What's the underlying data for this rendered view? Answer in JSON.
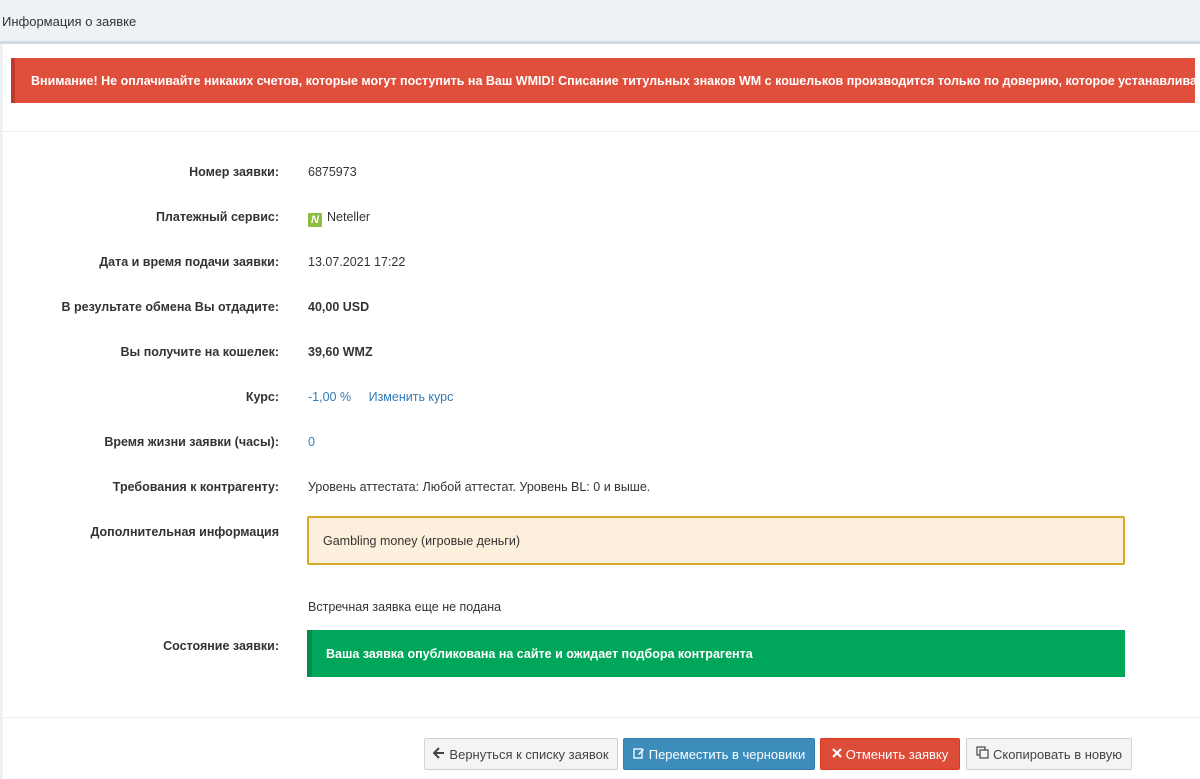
{
  "header": {
    "title": "Информация о заявке"
  },
  "alert": "Внимание! Не оплачивайте никаких счетов, которые могут поступить на Ваш WMID! Списание титульных знаков WM с кошельков производится только по доверию, которое устанавливается один раз.",
  "fields": {
    "order_number": {
      "label": "Номер заявки:",
      "value": "6875973"
    },
    "payment_service": {
      "label": "Платежный сервис:",
      "icon_letter": "N",
      "value": "Neteller"
    },
    "date": {
      "label": "Дата и время подачи заявки:",
      "value": "13.07.2021 17:22"
    },
    "give": {
      "label": "В результате обмена Вы отдадите:",
      "value": "40,00 USD"
    },
    "receive": {
      "label": "Вы получите на кошелек:",
      "value": "39,60 WMZ"
    },
    "rate": {
      "label": "Курс:",
      "value": "-1,00 %",
      "change_link": "Изменить курс"
    },
    "lifetime": {
      "label": "Время жизни заявки (часы):",
      "value": "0"
    },
    "requirements": {
      "label": "Требования к контрагенту:",
      "value": "Уровень аттестата: Любой аттестат. Уровень BL: 0 и выше."
    },
    "additional": {
      "label": "Дополнительная информация",
      "value": "Gambling money (игровые деньги)"
    },
    "counter_order": "Встречная заявка еще не подана",
    "status": {
      "label": "Состояние заявки:",
      "value": "Ваша заявка опубликована на сайте и ожидает подбора контрагента"
    }
  },
  "buttons": {
    "back": "Вернуться к списку заявок",
    "draft": "Переместить в черновики",
    "cancel": "Отменить заявку",
    "copy": "Скопировать в новую"
  },
  "colors": {
    "alert": "#e04e3c",
    "status": "#00a65a",
    "note_bg": "#fcefdc",
    "note_border": "#d9a72c",
    "link": "#337ab7"
  }
}
